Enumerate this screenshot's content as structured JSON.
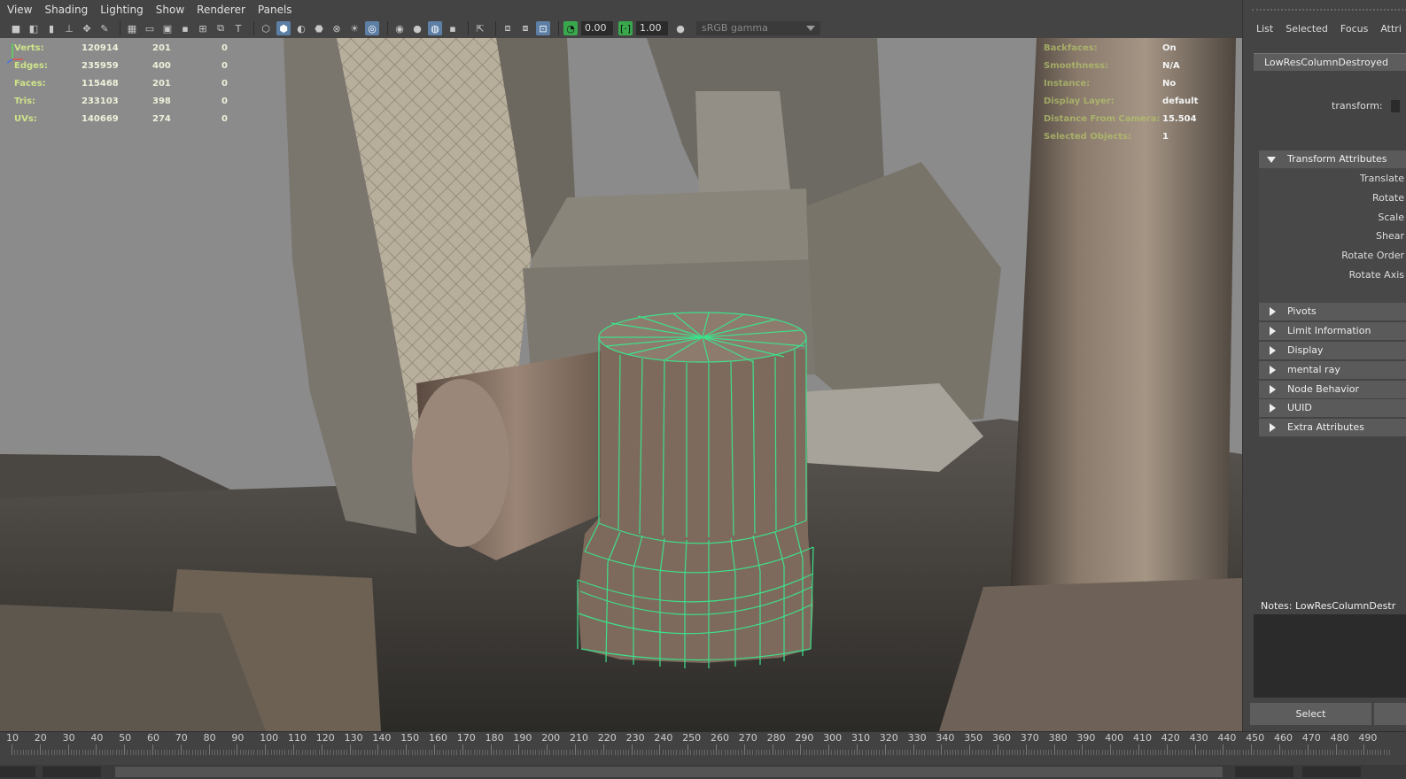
{
  "menu": {
    "items": [
      "View",
      "Shading",
      "Lighting",
      "Show",
      "Renderer",
      "Panels"
    ]
  },
  "toolbar": {
    "exposure_value": "0.00",
    "gamma_value": "1.00",
    "color_space": "sRGB gamma",
    "icons": [
      "camera-icon",
      "camera-attr-icon",
      "bookmark-icon",
      "image-plane-icon",
      "2d-pan-icon",
      "grease-pencil-icon",
      "grid-icon",
      "film-gate-icon",
      "resolution-gate-icon",
      "gate-mask-icon",
      "field-chart-icon",
      "safe-action-icon",
      "safe-title-icon",
      "wireframe-icon",
      "smooth-shade-icon",
      "default-lighting-icon",
      "shadows-icon",
      "xray-icon",
      "lights-icon",
      "textures-icon",
      "isolate-select-icon",
      "ambient-occlusion-icon",
      "motion-blur-icon",
      "anti-alias-icon",
      "dof-icon",
      "select-tool-icon",
      "camera-tumble-icon",
      "hud-icon",
      "snapshot-icon",
      "exposure-icon",
      "gamma-icon",
      "color-mgmt-icon"
    ]
  },
  "hud_left": {
    "rows": [
      {
        "label": "Verts:",
        "v1": "120914",
        "v2": "201",
        "v3": "0"
      },
      {
        "label": "Edges:",
        "v1": "235959",
        "v2": "400",
        "v3": "0"
      },
      {
        "label": "Faces:",
        "v1": "115468",
        "v2": "201",
        "v3": "0"
      },
      {
        "label": "Tris:",
        "v1": "233103",
        "v2": "398",
        "v3": "0"
      },
      {
        "label": "UVs:",
        "v1": "140669",
        "v2": "274",
        "v3": "0"
      }
    ]
  },
  "hud_right": {
    "rows": [
      {
        "label": "Backfaces:",
        "value": "On"
      },
      {
        "label": "Smoothness:",
        "value": "N/A"
      },
      {
        "label": "Instance:",
        "value": "No"
      },
      {
        "label": "Display Layer:",
        "value": "default"
      },
      {
        "label": "Distance From Camera:",
        "value": "15.504"
      },
      {
        "label": "Selected Objects:",
        "value": "1"
      }
    ]
  },
  "attribute_editor": {
    "tabs": [
      "List",
      "Selected",
      "Focus",
      "Attri"
    ],
    "node_tab": "LowResColumnDestroyed",
    "transform_label": "transform:",
    "sections_expanded": {
      "title": "Transform Attributes",
      "attributes": [
        "Translate",
        "Rotate",
        "Scale",
        "Shear",
        "Rotate Order",
        "Rotate Axis"
      ]
    },
    "sections_collapsed": [
      "Pivots",
      "Limit Information",
      "Display",
      "mental ray",
      "Node Behavior",
      "UUID",
      "Extra Attributes"
    ],
    "notes_label": "Notes:  LowResColumnDestr",
    "select_button": "Select"
  },
  "timeline": {
    "ticks": [
      "10",
      "20",
      "30",
      "40",
      "50",
      "60",
      "70",
      "80",
      "90",
      "100",
      "110",
      "120",
      "130",
      "140",
      "150",
      "160",
      "170",
      "180",
      "190",
      "200",
      "210",
      "220",
      "230",
      "240",
      "250",
      "260",
      "270",
      "280",
      "290",
      "300",
      "310",
      "320",
      "330",
      "340",
      "350",
      "360",
      "370",
      "380",
      "390",
      "400",
      "410",
      "420",
      "430",
      "440",
      "450",
      "460",
      "470",
      "480",
      "490"
    ]
  },
  "colors": {
    "wireframe_highlight": "#3ee08a",
    "hud_label": "#cde38a",
    "active_icon": "#5d7fa5",
    "ui_bg": "#444444"
  }
}
